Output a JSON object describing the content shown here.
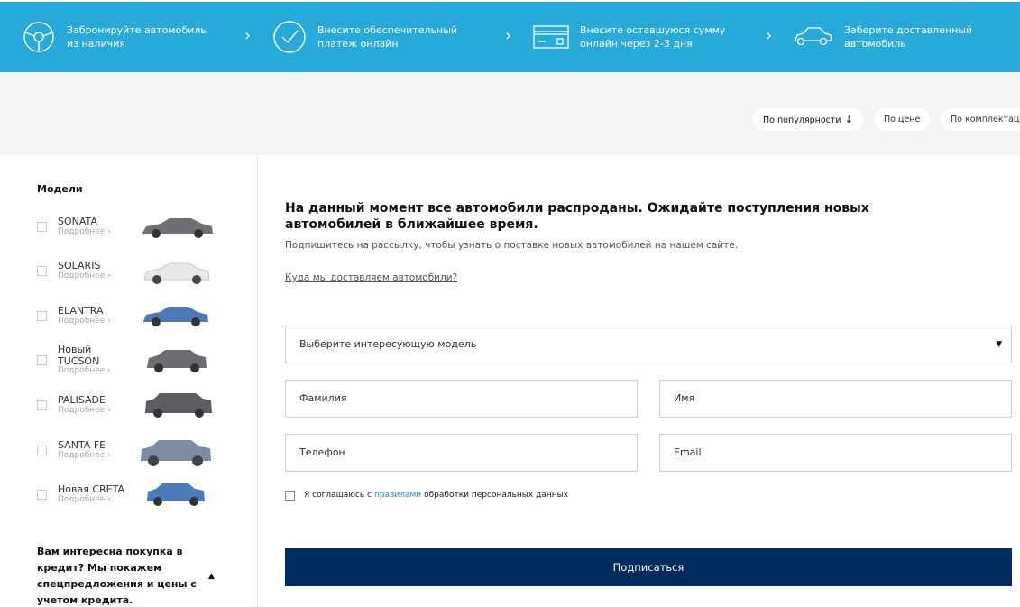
{
  "steps": [
    {
      "icon": "steering-wheel-icon",
      "text": "Забронируйте автомобиль из наличия"
    },
    {
      "icon": "check-circle-icon",
      "text": "Внесите обеспечительный платеж онлайн"
    },
    {
      "icon": "credit-card-icon",
      "text": "Внесите оставшуюся сумму онлайн через 2-3 дня"
    },
    {
      "icon": "car-outline-icon",
      "text": "Заберите доставленный автомобиль"
    }
  ],
  "step_separator": "›",
  "sort": {
    "popularity": "По популярности",
    "popularity_arrow": "↓",
    "price": "По цене",
    "trim": "По комплектации"
  },
  "sidebar": {
    "title": "Модели",
    "more_label": "Подробнее ›",
    "models": [
      {
        "name": "SONATA",
        "color": "#6e7076"
      },
      {
        "name": "SOLARIS",
        "color": "#e9e9e9"
      },
      {
        "name": "ELANTRA",
        "color": "#4f78b8"
      },
      {
        "name": "Новый TUCSON",
        "color": "#6b6d70"
      },
      {
        "name": "PALISADE",
        "color": "#5b5d61"
      },
      {
        "name": "SANTA FE",
        "color": "#7d8ca3"
      },
      {
        "name": "Новая CRETA",
        "color": "#4a7ab8"
      }
    ],
    "credit_text": "Вам интересна покупка в кредит? Мы покажем спецпредложения и цены с учетом кредита.",
    "credit_toggle": "▲"
  },
  "main": {
    "headline": "На данный момент все автомобили распроданы. Ожидайте поступления новых автомобилей в ближайшее время.",
    "subline": "Подпишитесь на рассылку, чтобы узнать о поставке новых автомобилей на нашем сайте.",
    "delivery_link": "Куда мы доставляем автомобили?",
    "form": {
      "model_select": "Выберите интересующую модель",
      "surname": "Фамилия",
      "name": "Имя",
      "phone": "Телефон",
      "email": "Email",
      "agree_prefix": "Я соглашаюсь с",
      "agree_link": "правилами",
      "agree_suffix": "обработки персональных данных",
      "submit": "Подписаться"
    }
  },
  "colors": {
    "banner": "#27a9d9",
    "submit": "#002c5f",
    "link": "#1e90c8"
  }
}
